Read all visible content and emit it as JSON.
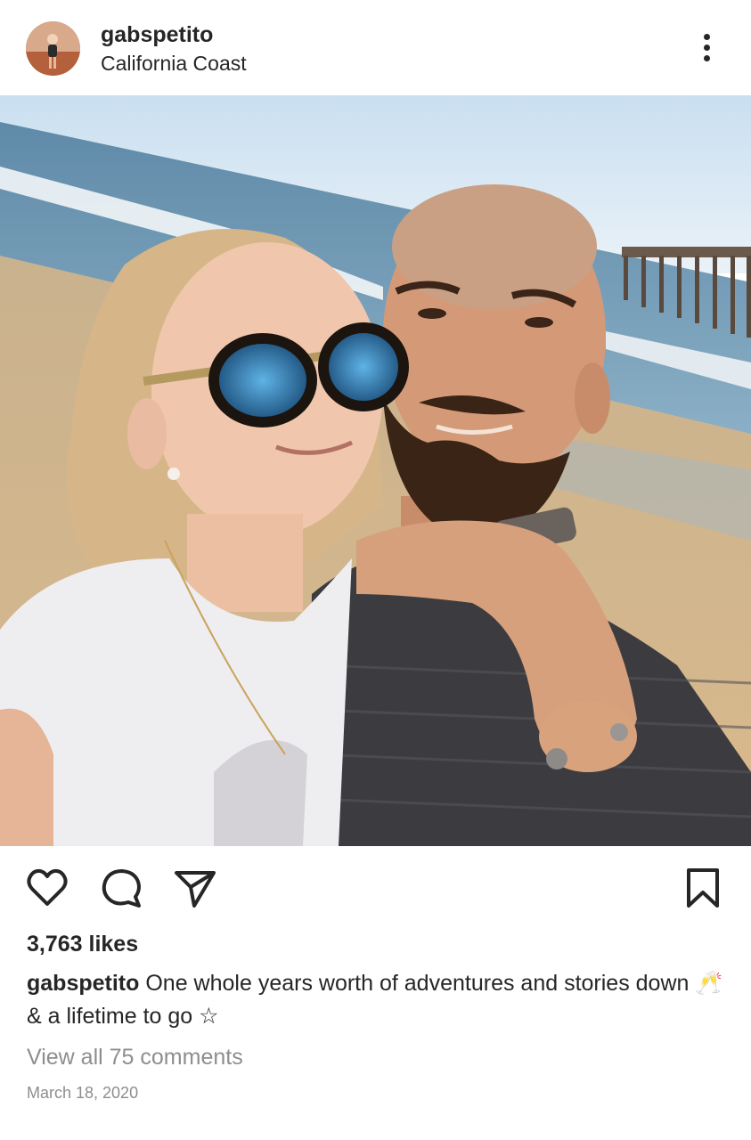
{
  "post": {
    "username": "gabspetito",
    "location": "California Coast",
    "likes": "3,763 likes",
    "caption": {
      "username": "gabspetito",
      "text": "One whole years worth of adventures and stories down 🥂 & a lifetime to go ☆"
    },
    "view_comments": "View all 75 comments",
    "date": "March 18, 2020"
  },
  "icons": {
    "more": "more-options-icon",
    "like": "heart-icon",
    "comment": "comment-bubble-icon",
    "share": "paper-plane-icon",
    "save": "bookmark-icon"
  },
  "colors": {
    "text": "#262626",
    "secondary_text": "#8e8e8e",
    "background": "#ffffff"
  }
}
